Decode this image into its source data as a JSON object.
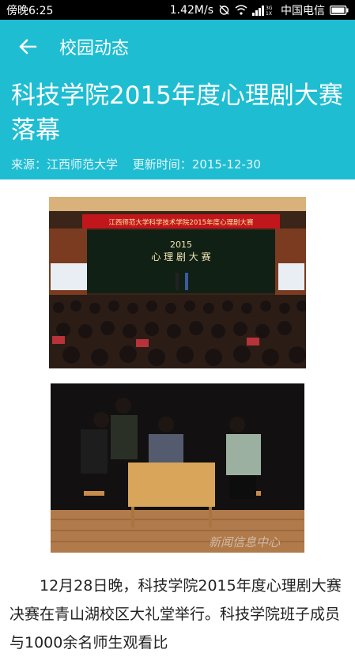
{
  "status_bar": {
    "time": "傍晚6:25",
    "speed": "1.42M/s",
    "carrier": "中国电信"
  },
  "toolbar": {
    "back_icon": "arrow-left-icon",
    "title": "校园动态"
  },
  "article": {
    "title": "科技学院2015年度心理剧大赛落幕",
    "source": "来源：江西师范大学",
    "updated": "更新时间：2015-12-30",
    "body": "12月28日晚，科技学院2015年度心理剧大赛决赛在青山湖校区大礼堂举行。科技学院班子成员与1000余名师生观看比"
  },
  "photos": {
    "stage_banner": "江西师范大学科学技术学院2015年度心理剧大赛",
    "stage_year": "2015",
    "stage_heading": "心 理 剧 大 赛",
    "watermark": "新闻信息中心"
  },
  "colors": {
    "header": "#1fbdd2",
    "status_bar": "#000000"
  }
}
